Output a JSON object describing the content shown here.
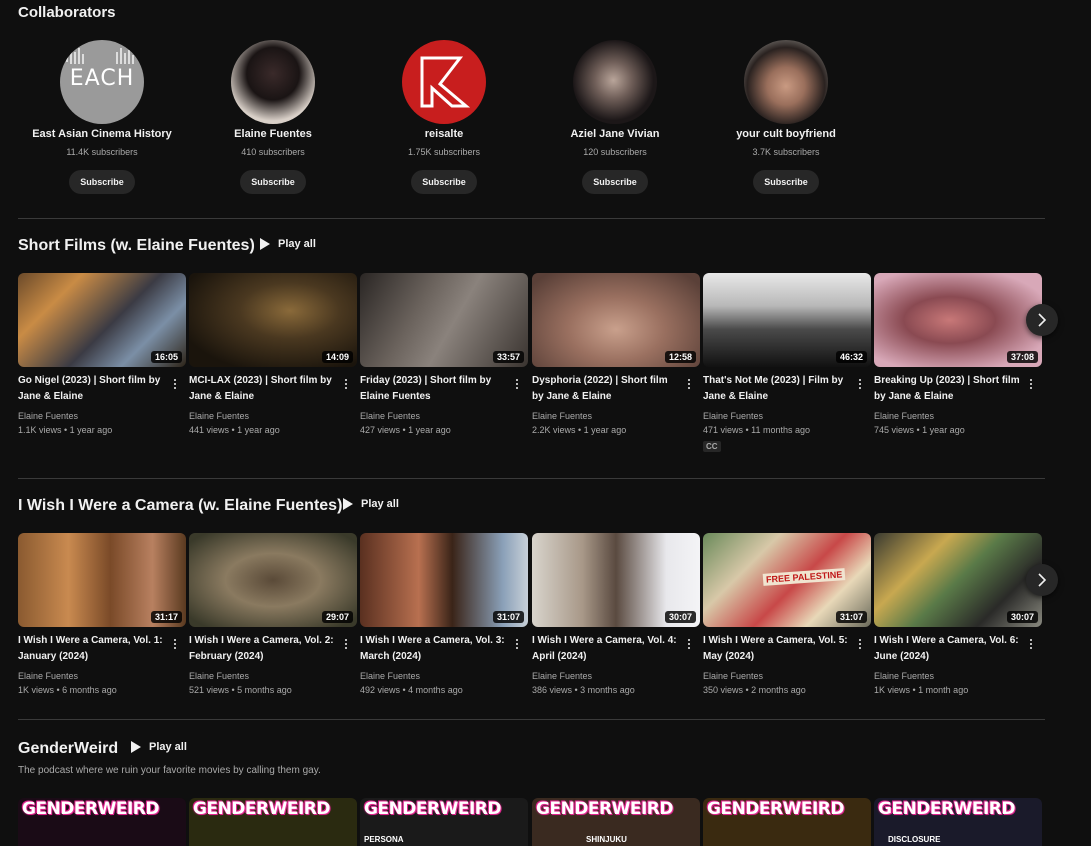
{
  "collaborators_section": {
    "title": "Collaborators",
    "subscribe_label": "Subscribe",
    "channels": [
      {
        "name": "East Asian Cinema History",
        "subs": "11.4K subscribers",
        "avatar_text": "EACH"
      },
      {
        "name": "Elaine Fuentes",
        "subs": "410 subscribers"
      },
      {
        "name": "reisalte",
        "subs": "1.75K subscribers"
      },
      {
        "name": "Aziel Jane Vivian",
        "subs": "120 subscribers"
      },
      {
        "name": "your cult boyfriend",
        "subs": "3.7K subscribers"
      }
    ]
  },
  "play_all_label": "Play all",
  "short_films": {
    "title": "Short Films (w. Elaine Fuentes)",
    "videos": [
      {
        "title": "Go Nigel (2023) | Short film by Jane & Elaine",
        "duration": "16:05",
        "channel": "Elaine Fuentes",
        "meta": "1.1K views • 1 year ago"
      },
      {
        "title": "MCI-LAX (2023) | Short film by Jane & Elaine",
        "duration": "14:09",
        "channel": "Elaine Fuentes",
        "meta": "441 views • 1 year ago"
      },
      {
        "title": "Friday (2023) | Short film by Elaine Fuentes",
        "duration": "33:57",
        "channel": "Elaine Fuentes",
        "meta": "427 views • 1 year ago"
      },
      {
        "title": "Dysphoria (2022) | Short film by Jane & Elaine",
        "duration": "12:58",
        "channel": "Elaine Fuentes",
        "meta": "2.2K views • 1 year ago"
      },
      {
        "title": "That's Not Me (2023) | Film by Jane & Elaine",
        "duration": "46:32",
        "channel": "Elaine Fuentes",
        "meta": "471 views • 11 months ago",
        "badge": "CC"
      },
      {
        "title": "Breaking Up (2023) | Short film by Jane & Elaine",
        "duration": "37:08",
        "channel": "Elaine Fuentes",
        "meta": "745 views • 1 year ago"
      }
    ]
  },
  "camera": {
    "title": "I Wish I Were a Camera (w. Elaine Fuentes)",
    "videos": [
      {
        "title": "I Wish I Were a Camera, Vol. 1: January (2024)",
        "duration": "31:17",
        "channel": "Elaine Fuentes",
        "meta": "1K views • 6 months ago"
      },
      {
        "title": "I Wish I Were a Camera, Vol. 2: February (2024)",
        "duration": "29:07",
        "channel": "Elaine Fuentes",
        "meta": "521 views • 5 months ago"
      },
      {
        "title": "I Wish I Were a Camera, Vol. 3: March (2024)",
        "duration": "31:07",
        "channel": "Elaine Fuentes",
        "meta": "492 views • 4 months ago"
      },
      {
        "title": "I Wish I Were a Camera, Vol. 4: April (2024)",
        "duration": "30:07",
        "channel": "Elaine Fuentes",
        "meta": "386 views • 3 months ago"
      },
      {
        "title": "I Wish I Were a Camera, Vol. 5: May (2024)",
        "duration": "31:07",
        "channel": "Elaine Fuentes",
        "meta": "350 views • 2 months ago",
        "thumb_text": "FREE PALESTINE"
      },
      {
        "title": "I Wish I Were a Camera, Vol. 6: June (2024)",
        "duration": "30:07",
        "channel": "Elaine Fuentes",
        "meta": "1K views • 1 month ago"
      }
    ]
  },
  "genderweird": {
    "title": "GenderWeird",
    "description": "The podcast where we ruin your favorite movies by calling them gay.",
    "thumb_word": "GENDERWEIRD",
    "thumb_subs": [
      "",
      "",
      "PERSONA",
      "SHINJUKU",
      "",
      "DISCLOSURE"
    ]
  }
}
